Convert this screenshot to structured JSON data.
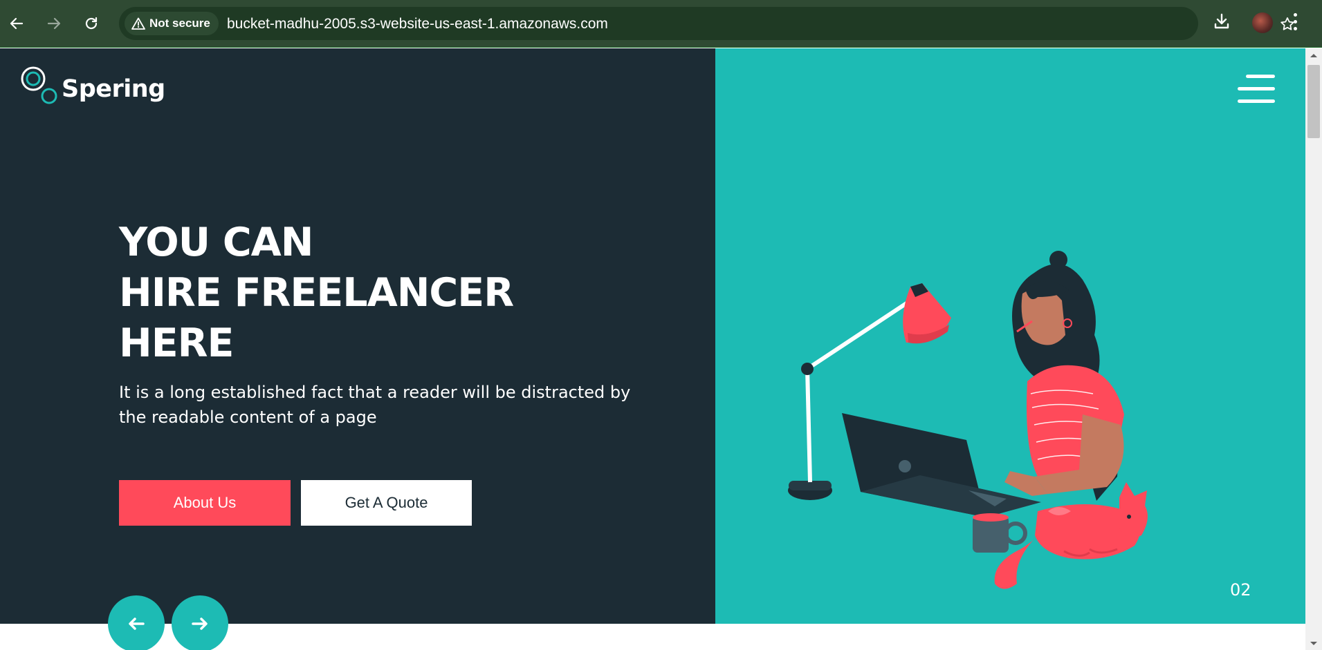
{
  "browser": {
    "security_label": "Not secure",
    "url": "bucket-madhu-2005.s3-website-us-east-1.amazonaws.com",
    "icons": [
      "back-icon",
      "forward-icon",
      "reload-icon",
      "warning-icon",
      "star-icon",
      "download-icon",
      "avatar",
      "more-vert-icon"
    ]
  },
  "site": {
    "logo_text": "Spering",
    "hero": {
      "title_line1": "YOU CAN",
      "title_line2": "HIRE FREELANCER",
      "title_line3": "HERE",
      "description": "It is a long established fact that a reader will be distracted by the readable content of a page"
    },
    "buttons": {
      "about_label": "About Us",
      "quote_label": "Get A Quote"
    },
    "slider": {
      "current_slide": "02"
    }
  },
  "colors": {
    "dark_panel": "#1c2c35",
    "teal": "#1dbbb4",
    "coral": "#ff4a5a",
    "chrome_bg": "#2f4a33"
  }
}
